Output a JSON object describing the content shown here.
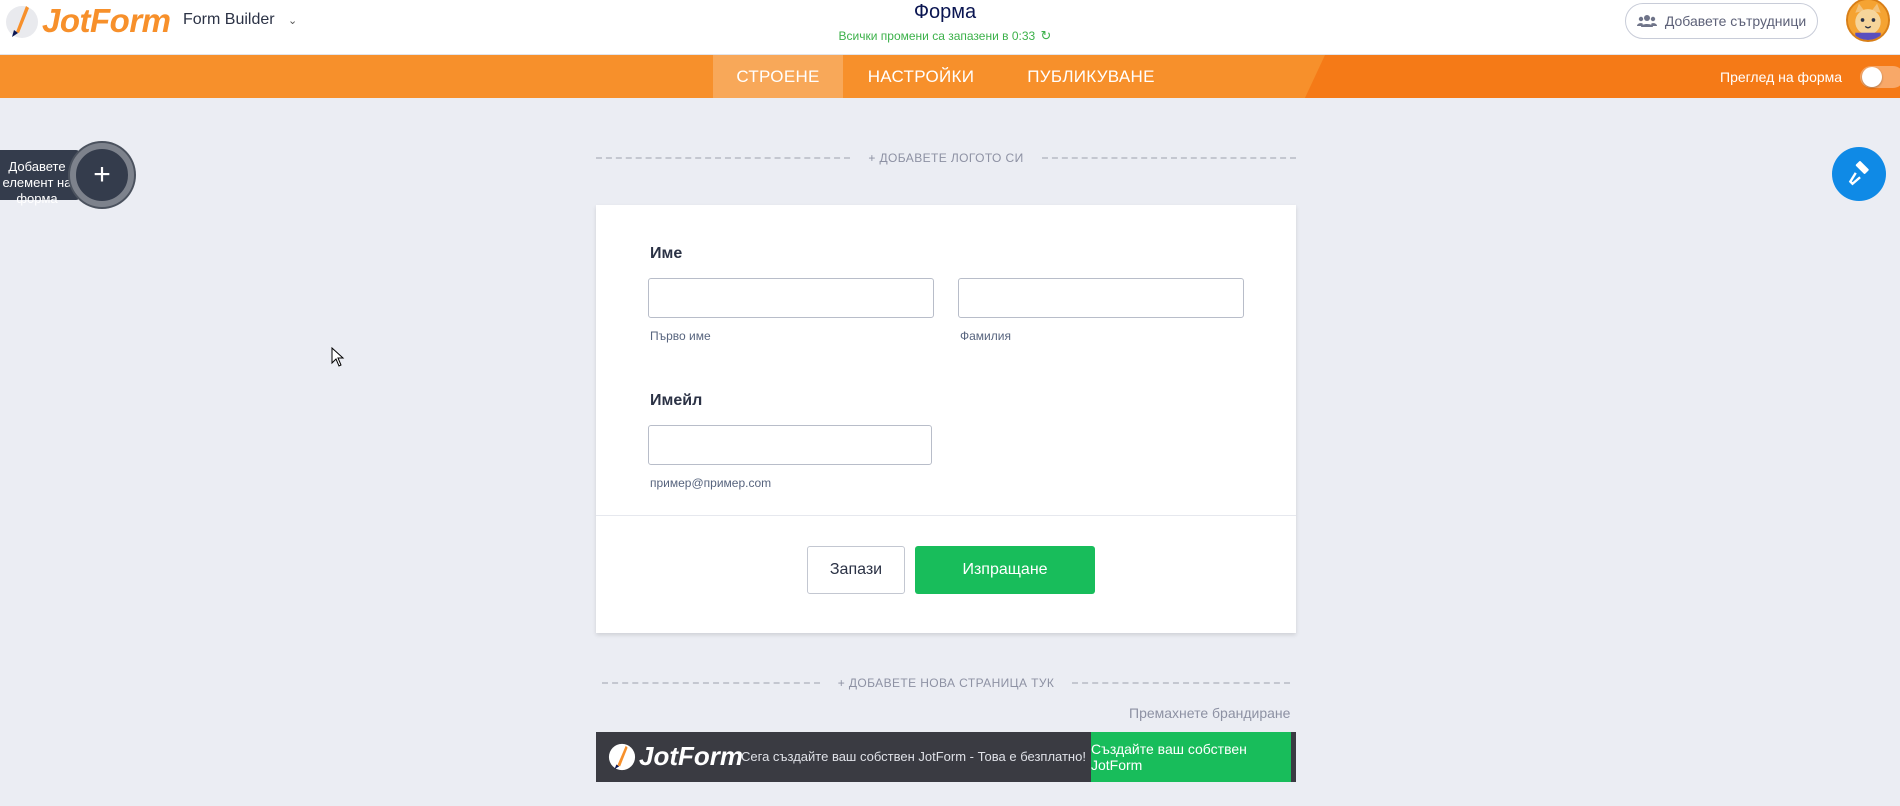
{
  "header": {
    "logo_text": "JotForm",
    "app_name": "Form Builder",
    "form_title": "Форма",
    "save_status": "Всички промени са запазени в 0:33",
    "collab_label": "Добавете сътрудници"
  },
  "nav": {
    "tabs": [
      {
        "label": "СТРОЕНЕ",
        "active": true
      },
      {
        "label": "НАСТРОЙКИ",
        "active": false
      },
      {
        "label": "ПУБЛИКУВАНЕ",
        "active": false
      }
    ],
    "preview_label": "Преглед на форма",
    "preview_enabled": false
  },
  "sidebar": {
    "add_element_label": "Добавете елемент на форма"
  },
  "canvas": {
    "add_logo": "+ ДОБАВЕТЕ ЛОГОТО СИ",
    "add_page": "+ ДОБАВЕТЕ НОВА СТРАНИЦА ТУК",
    "remove_branding": "Премахнете брандиране"
  },
  "form": {
    "name_label": "Име",
    "first_name_sublabel": "Първо име",
    "last_name_sublabel": "Фамилия",
    "first_name_value": "",
    "last_name_value": "",
    "email_label": "Имейл",
    "email_sublabel": "пример@пример.com",
    "email_value": "",
    "save_button": "Запази",
    "submit_button": "Изпращане"
  },
  "banner": {
    "logo_text": "JotForm",
    "text": "Сега създайте ваш собствен JotForm - Това е безплатно!",
    "cta": "Създайте ваш собствен JotForm"
  },
  "colors": {
    "brand_orange": "#f7902b",
    "submit_green": "#18bd5b",
    "designer_blue": "#0f8ae6",
    "saved_green": "#3cb14a"
  }
}
